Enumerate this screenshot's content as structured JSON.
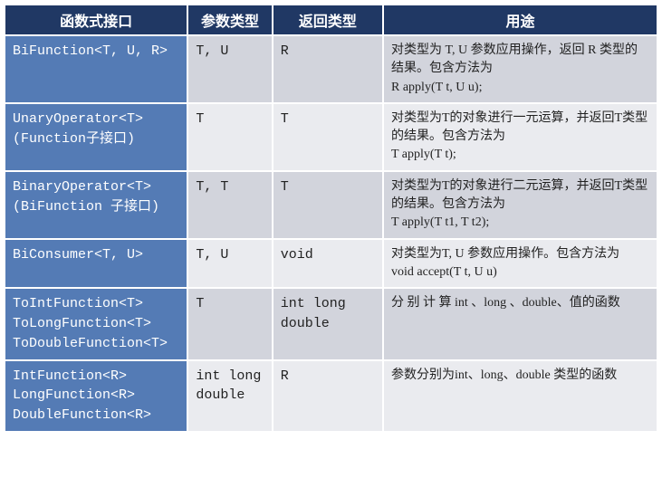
{
  "headers": {
    "interface": "函数式接口",
    "param": "参数类型",
    "ret": "返回类型",
    "use": "用途"
  },
  "rows": [
    {
      "interface": "BiFunction<T, U, R>",
      "param": "T, U",
      "ret": "R",
      "use": "对类型为 T, U 参数应用操作，返回 R 类型的结果。包含方法为\nR apply(T t, U u);"
    },
    {
      "interface": "UnaryOperator<T>\n(Function子接口)",
      "param": "T",
      "ret": "T",
      "use": "对类型为T的对象进行一元运算，并返回T类型的结果。包含方法为\nT apply(T t);"
    },
    {
      "interface": "BinaryOperator<T>\n(BiFunction 子接口)",
      "param": "T, T",
      "ret": "T",
      "use": "对类型为T的对象进行二元运算，并返回T类型的结果。包含方法为\nT apply(T t1, T t2);"
    },
    {
      "interface": "BiConsumer<T, U>",
      "param": "T, U",
      "ret": "void",
      "use": "对类型为T, U 参数应用操作。包含方法为\nvoid accept(T t, U u)"
    },
    {
      "interface": "ToIntFunction<T>\nToLongFunction<T>\nToDoubleFunction<T>",
      "param": "T",
      "ret": "int\nlong\ndouble",
      "use": "分 别 计 算 int 、long 、double、值的函数"
    },
    {
      "interface": "IntFunction<R>\nLongFunction<R>\nDoubleFunction<R>",
      "param": "int\nlong\ndouble",
      "ret": "R",
      "use": "参数分别为int、long、double 类型的函数"
    }
  ]
}
